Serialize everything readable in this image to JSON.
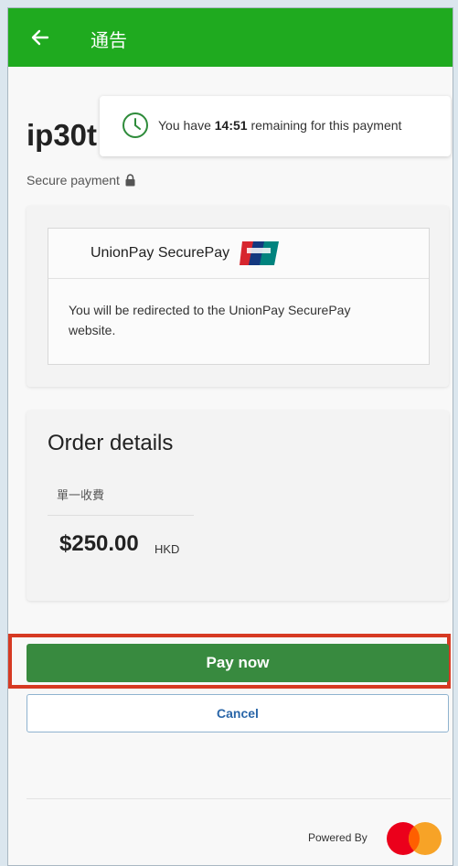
{
  "appbar": {
    "title": "通告",
    "back_icon": "arrow-left-icon"
  },
  "merchant": {
    "name": "ip30t"
  },
  "timer": {
    "prefix": "You have ",
    "time": "14:51",
    "suffix": " remaining for this payment",
    "icon": "clock-icon"
  },
  "secure": {
    "label": "Secure payment",
    "icon": "lock-icon"
  },
  "payment_method": {
    "name": "UnionPay SecurePay",
    "logo_icon": "unionpay-logo-icon",
    "description": "You will be redirected to the UnionPay SecurePay website."
  },
  "order": {
    "title": "Order details",
    "item": "單一收費",
    "amount": "$250.00",
    "currency": "HKD"
  },
  "actions": {
    "pay_label": "Pay now",
    "cancel_label": "Cancel"
  },
  "footer": {
    "powered_by": "Powered By",
    "logo_icon": "mastercard-logo-icon"
  },
  "colors": {
    "appbar": "#1faa1f",
    "pay_button": "#388a3f",
    "cancel_text": "#2a66a8",
    "highlight": "#d63a23",
    "clock": "#2e8b3a"
  }
}
